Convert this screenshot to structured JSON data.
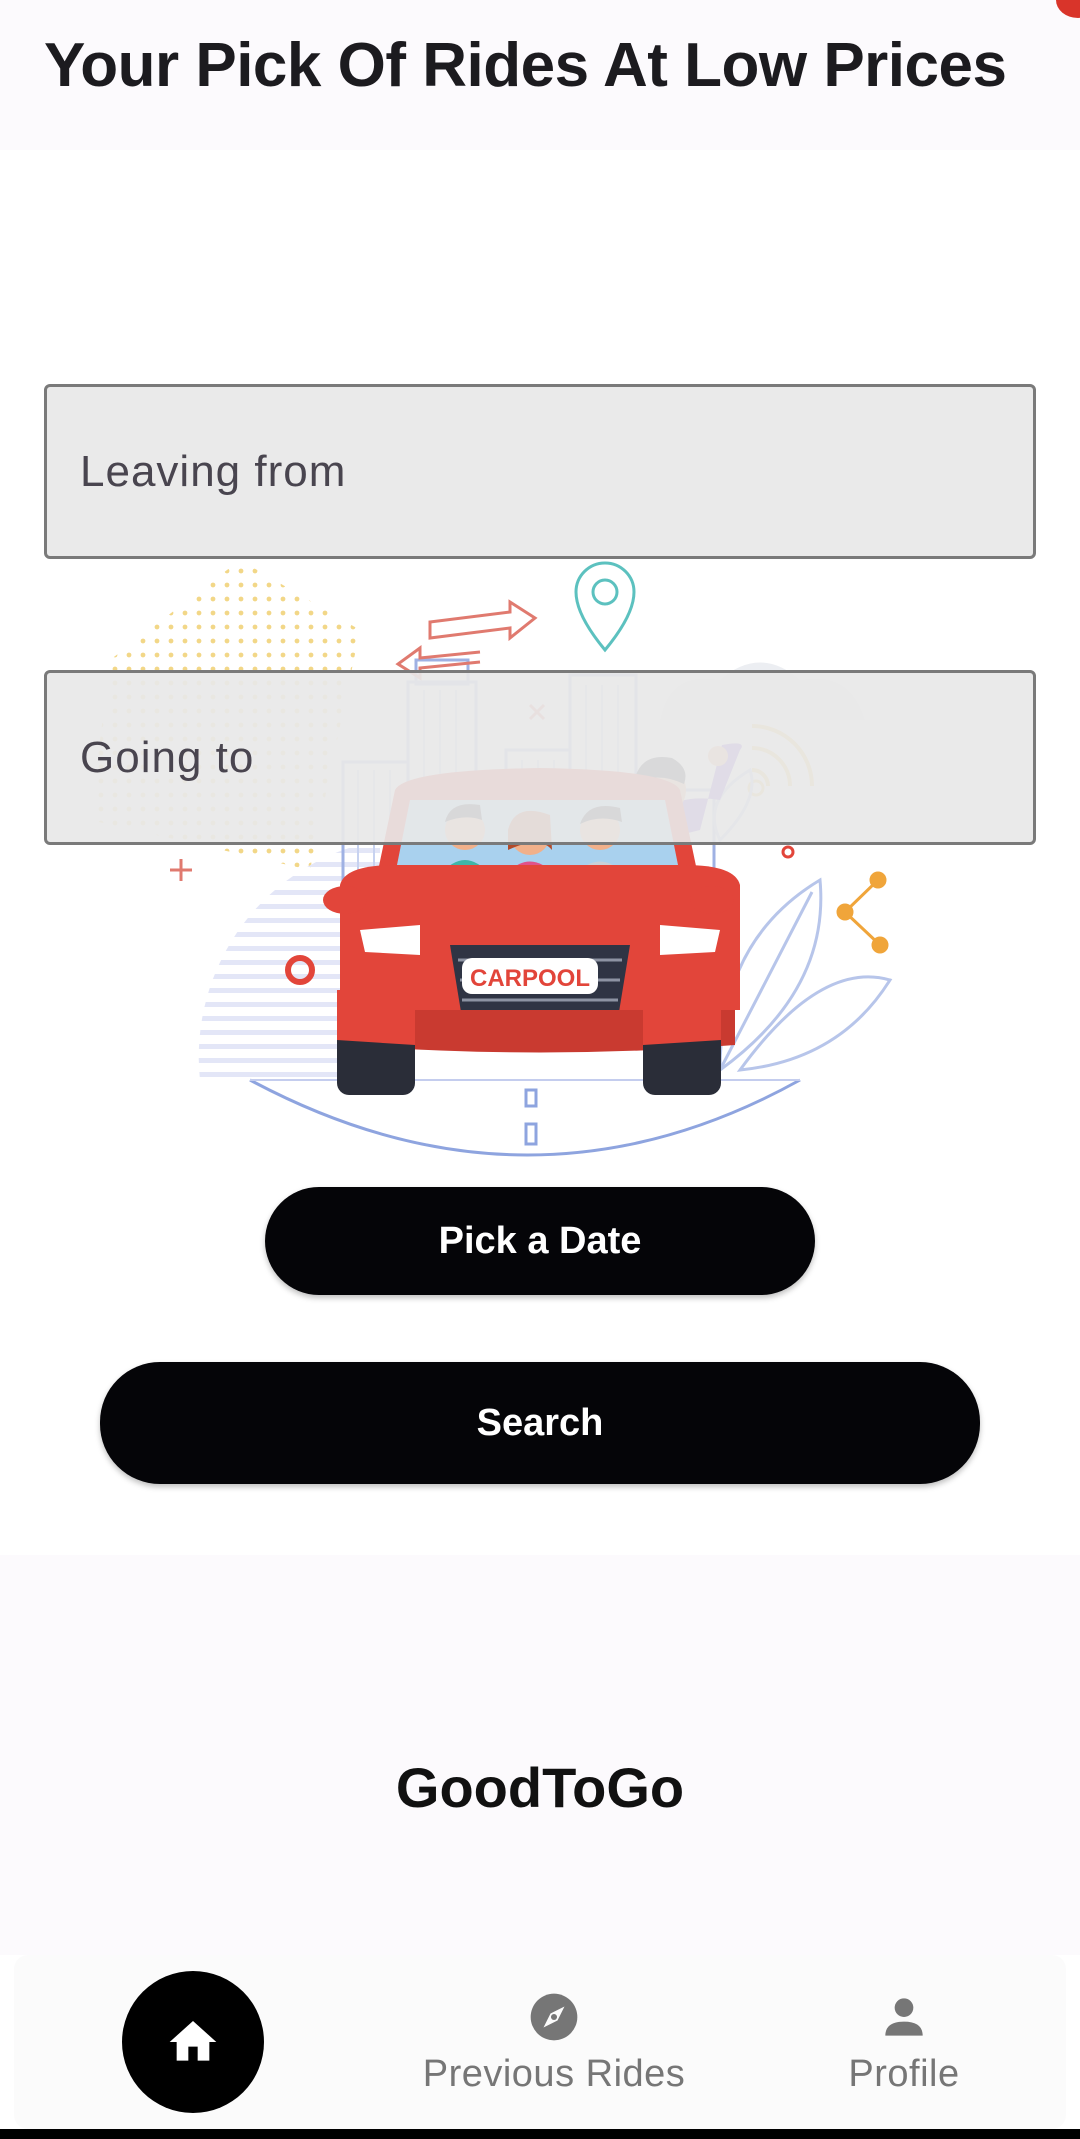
{
  "header": {
    "title": "Your Pick Of Rides At Low Prices"
  },
  "illustration": {
    "car_plate_text": "CARPOOL"
  },
  "form": {
    "leaving_placeholder": "Leaving from",
    "going_placeholder": "Going to",
    "pick_date_label": "Pick a Date",
    "search_label": "Search"
  },
  "footer": {
    "brand": "GoodToGo"
  },
  "bottom_nav": {
    "items": [
      {
        "label": "",
        "icon": "home-icon",
        "active": true
      },
      {
        "label": "Previous Rides",
        "icon": "compass-icon",
        "active": false
      },
      {
        "label": "Profile",
        "icon": "person-icon",
        "active": false
      }
    ]
  },
  "colors": {
    "accent": "#000000",
    "car_red": "#e2453a",
    "field_bg": "#e8e8e8"
  }
}
